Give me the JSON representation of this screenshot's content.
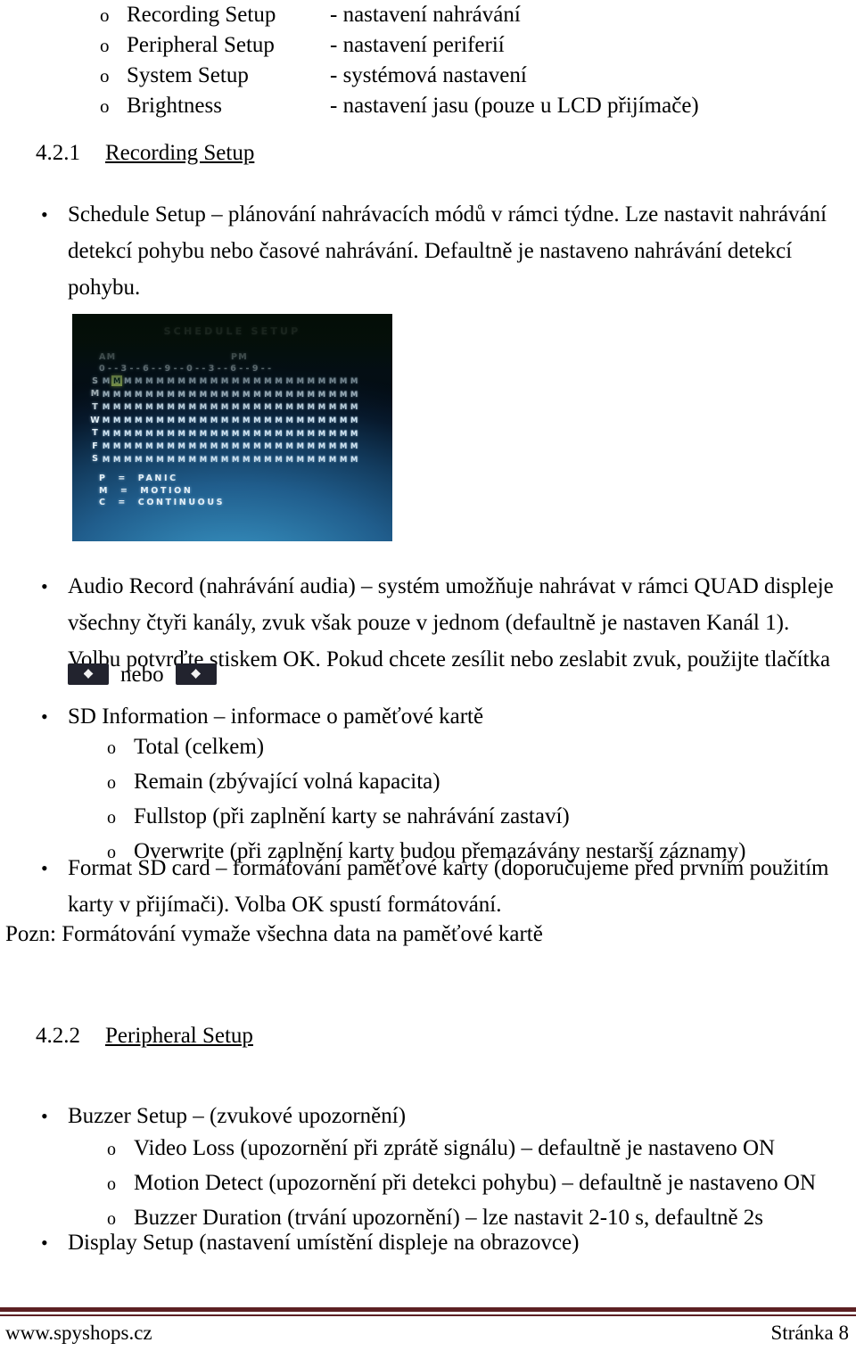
{
  "document": {
    "menu_list": [
      {
        "marker": "o",
        "term": "Recording Setup",
        "desc": "- nastavení nahrávání"
      },
      {
        "marker": "o",
        "term": "Peripheral Setup",
        "desc": "- nastavení periferií"
      },
      {
        "marker": "o",
        "term": "System Setup",
        "desc": "- systémová nastavení"
      },
      {
        "marker": "o",
        "term": "Brightness",
        "desc": "- nastavení jasu (pouze u LCD přijímače)"
      }
    ],
    "heading_421": {
      "number": "4.2.1",
      "title": "Recording Setup"
    },
    "schedule_bullet": {
      "marker": "•",
      "line1": "Schedule Setup – plánování nahrávacích módů v rámci týdne. Lze nastavit nahrávání",
      "line2": "detekcí pohybu nebo časové nahrávání. Defaultně je nastaveno nahrávání detekcí",
      "line3": "pohybu."
    },
    "audio_bullet": {
      "marker": "•",
      "line1": "Audio Record (nahrávání audia) – systém umožňuje nahrávat v rámci QUAD displeje",
      "line2": "všechny čtyři kanály, zvuk však pouze v jednom (defaultně je nastaven Kanál 1).",
      "line3": "Volbu potvrďte stiskem OK. Pokud chcete zesílit nebo zeslabit zvuk, použijte tlačítka",
      "key_separator": "nebo"
    },
    "sd_information": {
      "marker": "•",
      "title": "SD Information – informace o paměťové kartě",
      "items": [
        {
          "marker": "o",
          "text": "Total (celkem)"
        },
        {
          "marker": "o",
          "text": "Remain (zbývající volná kapacita)"
        },
        {
          "marker": "o",
          "text": "Fullstop (při zaplnění karty se nahrávání zastaví)"
        },
        {
          "marker": "o",
          "text": "Overwrite (při zaplnění karty budou přemazávány nestarší záznamy)"
        }
      ]
    },
    "format_bullet": {
      "marker": "•",
      "line1": "Format SD card – formátování paměťové karty (doporučujeme před prvním použitím",
      "line2": "karty v přijímači). Volba OK spustí formátování."
    },
    "note": "Pozn: Formátování vymaže všechna data na paměťové kartě",
    "heading_422": {
      "number": "4.2.2",
      "title": "Peripheral Setup"
    },
    "buzzer_setup": {
      "marker": "•",
      "title": "Buzzer Setup – (zvukové upozornění)",
      "items": [
        {
          "marker": "o",
          "text": "Video Loss (upozornění při zprátě signálu) – defaultně je nastaveno ON"
        },
        {
          "marker": "o",
          "text": "Motion Detect (upozornění při detekci pohybu) – defaultně je nastaveno ON"
        },
        {
          "marker": "o",
          "text": "Buzzer Duration (trvání upozornění) – lze nastavit 2-10 s, defaultně 2s"
        }
      ]
    },
    "display_setup": {
      "marker": "•",
      "text": "Display Setup (nastavení umístění displeje na obrazovce)"
    },
    "footer": {
      "left": "www.spyshops.cz",
      "right": "Stránka 8",
      "rule_color": "#5C2023"
    }
  },
  "crt_screenshot": {
    "title": "SCHEDULE SETUP",
    "am_label": "AM",
    "pm_label": "PM",
    "hour_scale": "0--3--6--9--0--3--6--9--",
    "days": [
      "S",
      "M",
      "T",
      "W",
      "T",
      "F",
      "S"
    ],
    "cells_per_day": 24,
    "cell_mode": "M",
    "highlight": {
      "row": 0,
      "col": 1
    },
    "legend": [
      "P  =  PANIC",
      "M  =  MOTION",
      "C  =  CONTINUOUS"
    ],
    "legend_codes": [
      {
        "code": "P",
        "meaning": "PANIC"
      },
      {
        "code": "M",
        "meaning": "MOTION"
      },
      {
        "code": "C",
        "meaning": "CONTINUOUS"
      }
    ],
    "colors": {
      "screen_top": "#060d06",
      "screen_bottom": "#2a7ba8",
      "text": "#e2eef5",
      "highlight": "#b9d860"
    }
  }
}
